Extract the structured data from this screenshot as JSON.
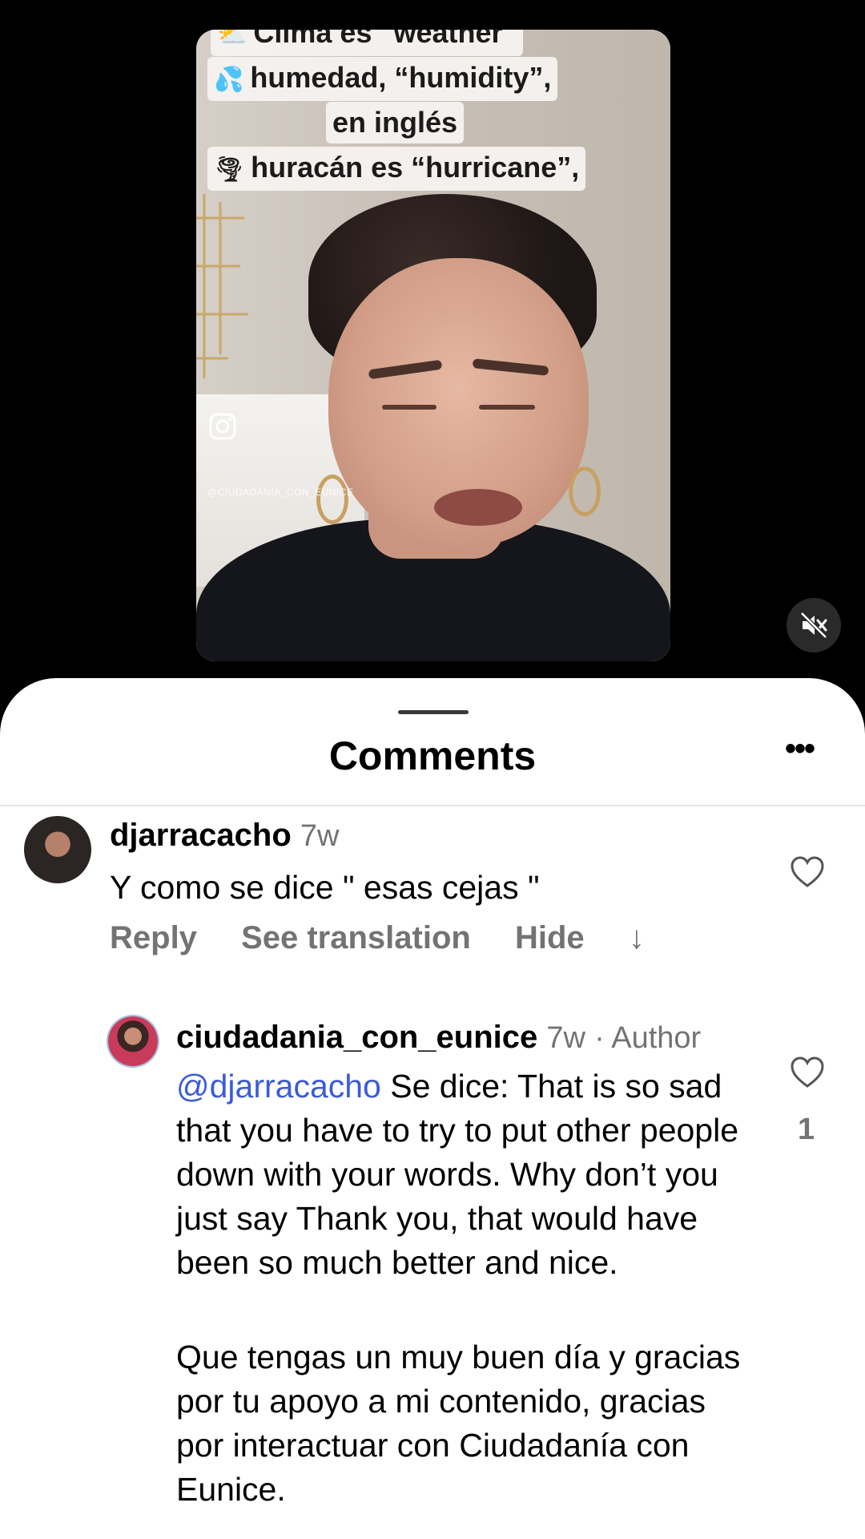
{
  "video": {
    "captions": [
      {
        "emoji": "⛅",
        "text": "Clima es \"weather\""
      },
      {
        "emoji": "💦",
        "text": "humedad, “humidity”,"
      },
      {
        "emoji": "",
        "text": "en inglés"
      },
      {
        "emoji": "🌪",
        "text": "huracán es “hurricane”,"
      }
    ],
    "watermark_handle": "@CIUDADANIA_CON_EUNICE",
    "mute_icon": "speaker-muted-icon"
  },
  "sheet": {
    "title": "Comments",
    "more_icon": "more-options-icon"
  },
  "comments": [
    {
      "username": "djarracacho",
      "time": "7w",
      "text": "Y como se dice \" esas cejas \"",
      "actions": {
        "reply": "Reply",
        "translate": "See translation",
        "hide": "Hide",
        "arrow": "↓"
      }
    },
    {
      "username": "ciudadania_con_eunice",
      "time": "7w",
      "role": "· Author",
      "mention": "@djarracacho",
      "text_p1": "Se dice: That is so sad that you have to try to put other people down with your words. Why don’t you just say Thank you, that would have been so much better and nice.",
      "text_p2": "Que tengas un muy buen día y gracias por tu apoyo a mi contenido, gracias por interactuar con Ciudadanía con Eunice.",
      "likes": "1"
    }
  ],
  "colors": {
    "mention": "#3b5bdb",
    "meta": "#737373",
    "sheet_bg": "#ffffff",
    "background": "#000000"
  }
}
